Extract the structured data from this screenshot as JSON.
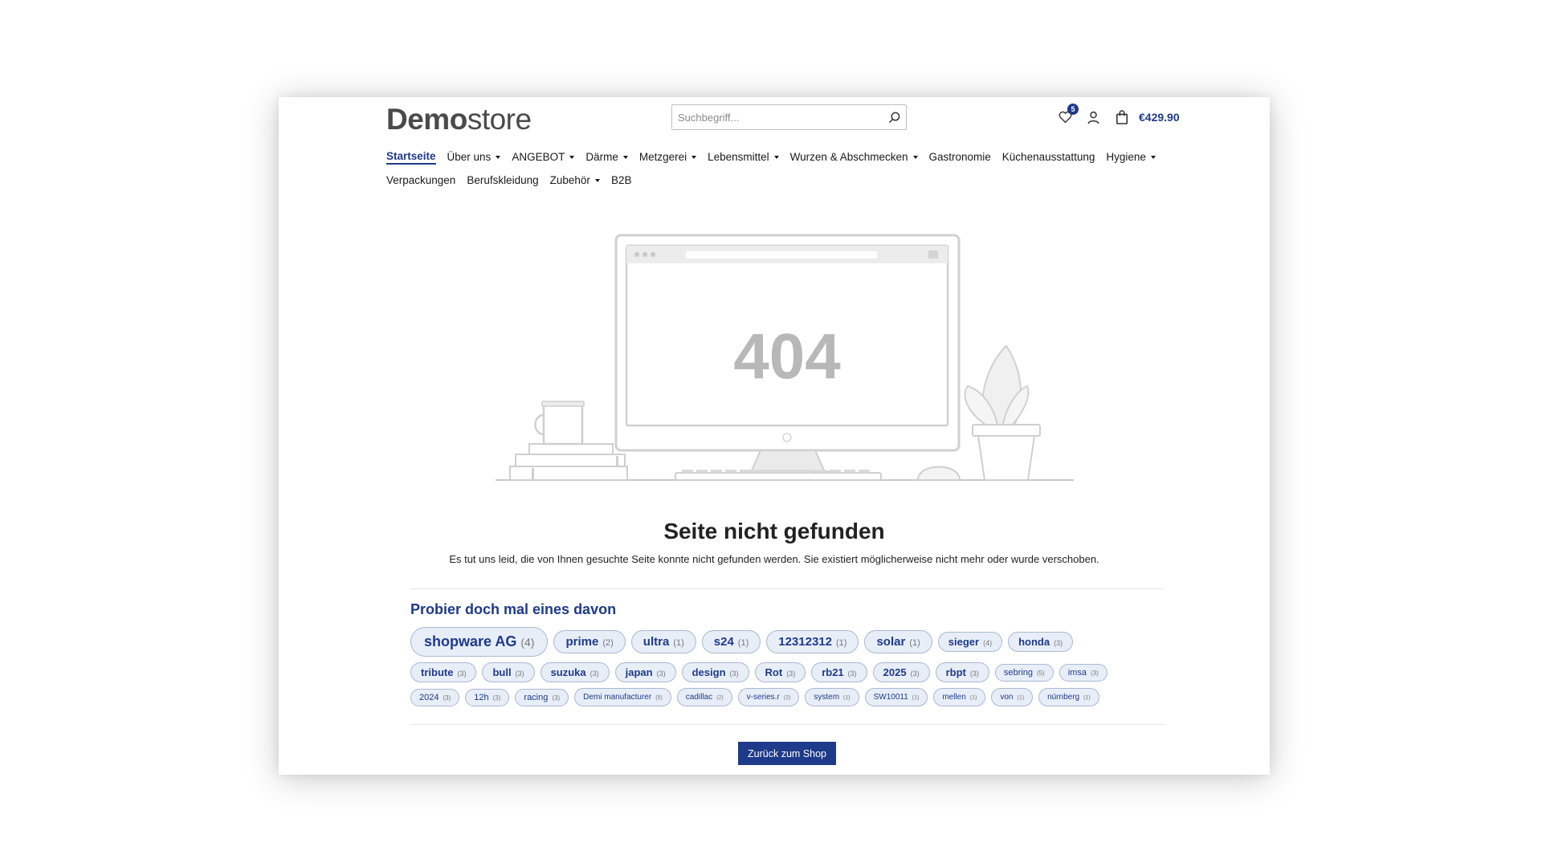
{
  "brand": {
    "logo_bold": "Demo",
    "logo_light": "store",
    "accent": "#1e3a8a"
  },
  "search": {
    "placeholder": "Suchbegriff..."
  },
  "header": {
    "wishlist_count": "5",
    "cart_total": "€429.90"
  },
  "nav": {
    "row1": [
      {
        "label": "Startseite",
        "active": true,
        "dropdown": false
      },
      {
        "label": "Über uns",
        "dropdown": true
      },
      {
        "label": "ANGEBOT",
        "dropdown": true
      },
      {
        "label": "Därme",
        "dropdown": true
      },
      {
        "label": "Metzgerei",
        "dropdown": true
      },
      {
        "label": "Lebensmittel",
        "dropdown": true
      },
      {
        "label": "Wurzen & Abschmecken",
        "dropdown": true
      },
      {
        "label": "Gastronomie",
        "dropdown": false
      },
      {
        "label": "Küchenausstattung",
        "dropdown": false
      },
      {
        "label": "Hygiene",
        "dropdown": true
      }
    ],
    "row2": [
      {
        "label": "Verpackungen",
        "dropdown": false
      },
      {
        "label": "Berufskleidung",
        "dropdown": false
      },
      {
        "label": "Zubehör",
        "dropdown": true
      },
      {
        "label": "B2B",
        "dropdown": false
      }
    ]
  },
  "error": {
    "code": "404",
    "title": "Seite nicht gefunden",
    "text": "Es tut uns leid, die von Ihnen gesuchte Seite konnte nicht gefunden werden. Sie existiert möglicherweise nicht mehr oder wurde verschoben."
  },
  "suggestions": {
    "title": "Probier doch mal eines davon",
    "rows": [
      [
        {
          "label": "shopware AG",
          "count": "(4)",
          "size": 1
        },
        {
          "label": "prime",
          "count": "(2)",
          "size": 2
        },
        {
          "label": "ultra",
          "count": "(1)",
          "size": 2
        },
        {
          "label": "s24",
          "count": "(1)",
          "size": 2
        },
        {
          "label": "12312312",
          "count": "(1)",
          "size": 2
        },
        {
          "label": "solar",
          "count": "(1)",
          "size": 2
        },
        {
          "label": "sieger",
          "count": "(4)",
          "size": 3
        },
        {
          "label": "honda",
          "count": "(3)",
          "size": 3
        }
      ],
      [
        {
          "label": "tribute",
          "count": "(3)",
          "size": 3
        },
        {
          "label": "bull",
          "count": "(3)",
          "size": 3
        },
        {
          "label": "suzuka",
          "count": "(3)",
          "size": 3
        },
        {
          "label": "japan",
          "count": "(3)",
          "size": 3
        },
        {
          "label": "design",
          "count": "(3)",
          "size": 3
        },
        {
          "label": "Rot",
          "count": "(3)",
          "size": 3
        },
        {
          "label": "rb21",
          "count": "(3)",
          "size": 3
        },
        {
          "label": "2025",
          "count": "(3)",
          "size": 3
        },
        {
          "label": "rbpt",
          "count": "(3)",
          "size": 3
        },
        {
          "label": "sebring",
          "count": "(5)",
          "size": 4
        },
        {
          "label": "imsa",
          "count": "(3)",
          "size": 4
        }
      ],
      [
        {
          "label": "2024",
          "count": "(3)",
          "size": 4
        },
        {
          "label": "12h",
          "count": "(3)",
          "size": 4
        },
        {
          "label": "racing",
          "count": "(3)",
          "size": 4
        },
        {
          "label": "Demi manufacturer",
          "count": "(5)",
          "size": 5
        },
        {
          "label": "cadillac",
          "count": "(2)",
          "size": 5
        },
        {
          "label": "v-series.r",
          "count": "(2)",
          "size": 5
        },
        {
          "label": "system",
          "count": "(1)",
          "size": 5
        },
        {
          "label": "SW10011",
          "count": "(1)",
          "size": 5
        },
        {
          "label": "mellen",
          "count": "(1)",
          "size": 5
        },
        {
          "label": "von",
          "count": "(1)",
          "size": 5
        },
        {
          "label": "nürnberg",
          "count": "(1)",
          "size": 5
        }
      ]
    ]
  },
  "back_button": "Zurück zum Shop"
}
